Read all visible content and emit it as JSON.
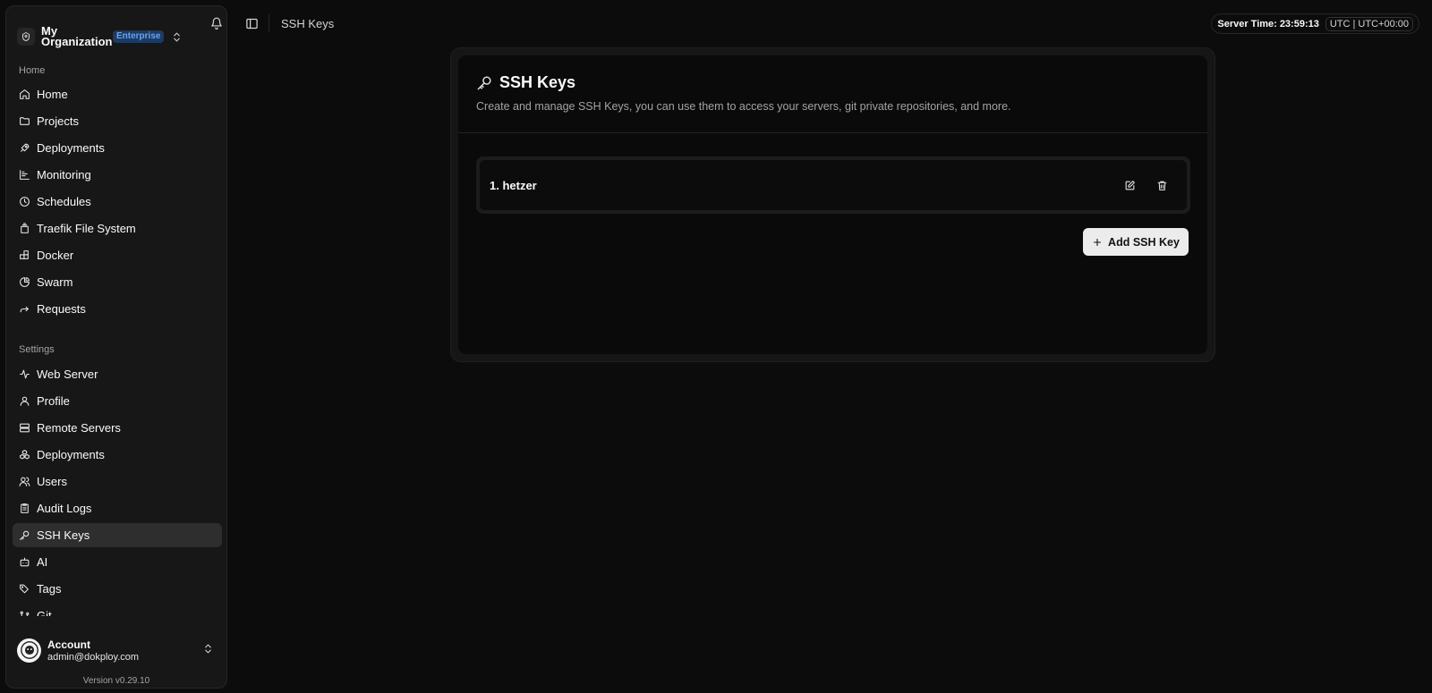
{
  "org": {
    "name": "My Organization",
    "badge": "Enterprise",
    "logo_icon": "org-logo-icon"
  },
  "sidebar": {
    "groups": [
      {
        "label": "Home"
      },
      {
        "label": "Settings"
      }
    ],
    "home_items": [
      {
        "label": "Home",
        "icon": "home-icon"
      },
      {
        "label": "Projects",
        "icon": "folder-icon"
      },
      {
        "label": "Deployments",
        "icon": "rocket-icon"
      },
      {
        "label": "Monitoring",
        "icon": "chart-icon"
      },
      {
        "label": "Schedules",
        "icon": "clock-icon"
      },
      {
        "label": "Traefik File System",
        "icon": "file-stack-icon"
      },
      {
        "label": "Docker",
        "icon": "blocks-icon"
      },
      {
        "label": "Swarm",
        "icon": "pie-icon"
      },
      {
        "label": "Requests",
        "icon": "forward-icon"
      }
    ],
    "settings_items": [
      {
        "label": "Web Server",
        "icon": "activity-icon"
      },
      {
        "label": "Profile",
        "icon": "user-icon"
      },
      {
        "label": "Remote Servers",
        "icon": "server-icon"
      },
      {
        "label": "Deployments",
        "icon": "boxes-icon"
      },
      {
        "label": "Users",
        "icon": "users-icon"
      },
      {
        "label": "Audit Logs",
        "icon": "clipboard-icon"
      },
      {
        "label": "SSH Keys",
        "icon": "key-icon",
        "active": true
      },
      {
        "label": "AI",
        "icon": "bot-icon"
      },
      {
        "label": "Tags",
        "icon": "tags-icon"
      },
      {
        "label": "Git",
        "icon": "git-icon"
      }
    ]
  },
  "account": {
    "title": "Account",
    "email": "admin@dokploy.com"
  },
  "version": "Version v0.29.10",
  "topbar": {
    "breadcrumb": "SSH Keys",
    "server_time_label": "Server Time:",
    "server_time": "23:59:13",
    "timezone": "UTC | UTC+00:00"
  },
  "page": {
    "title": "SSH Keys",
    "description": "Create and manage SSH Keys, you can use them to access your servers, git private repositories, and more.",
    "keys": [
      {
        "label": "1. hetzer"
      }
    ],
    "add_button": "Add SSH Key"
  },
  "colors": {
    "background": "#0c0c0c",
    "sidebar": "#171717",
    "badge": "#60a5fa",
    "active_item": "#2e2e2e",
    "primary_button": "#ececec"
  }
}
